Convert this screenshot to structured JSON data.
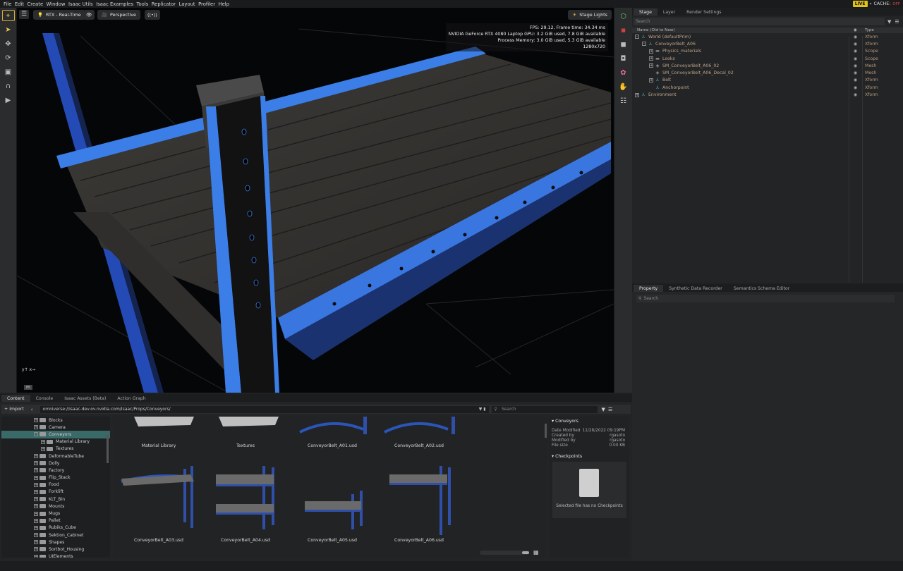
{
  "menu": [
    "File",
    "Edit",
    "Create",
    "Window",
    "Isaac Utils",
    "Isaac Examples",
    "Tools",
    "Replicator",
    "Layout",
    "Profiler",
    "Help"
  ],
  "status_right": {
    "live": "LIVE",
    "cache": "CACHE:",
    "cache_state": "OFF"
  },
  "viewport": {
    "renderer": "RTX - Real-Time",
    "camera": "Perspective",
    "lights": "Stage Lights",
    "stats": [
      "FPS: 29.12, Frame time: 34.34 ms",
      "NVIDIA GeForce RTX 4080 Laptop GPU: 3.2 GiB used, 7.8 GiB available",
      "Process Memory: 3.0 GiB used, 5.3 GiB available",
      "1280x720"
    ],
    "axis_label": "m"
  },
  "stage": {
    "tabs": [
      "Stage",
      "Layer",
      "Render Settings"
    ],
    "search_placeholder": "Search",
    "col_name": "Name (Old to New)",
    "col_type": "Type",
    "rows": [
      {
        "name": "World (defaultPrim)",
        "type": "Xform",
        "indent": 0,
        "toggle": "-",
        "icon": "xform-icon"
      },
      {
        "name": "ConveyorBelt_A06",
        "type": "Xform",
        "indent": 1,
        "toggle": "-",
        "icon": "xform-icon"
      },
      {
        "name": "Physics_materials",
        "type": "Scope",
        "indent": 2,
        "toggle": "+",
        "icon": "folder-icon"
      },
      {
        "name": "Looks",
        "type": "Scope",
        "indent": 2,
        "toggle": "+",
        "icon": "folder-icon"
      },
      {
        "name": "SM_ConveyorBelt_A06_02",
        "type": "Mesh",
        "indent": 2,
        "toggle": "+",
        "icon": "mesh-icon"
      },
      {
        "name": "SM_ConveyorBelt_A06_Decal_02",
        "type": "Mesh",
        "indent": 2,
        "toggle": "",
        "icon": "mesh-icon"
      },
      {
        "name": "Belt",
        "type": "Xform",
        "indent": 2,
        "toggle": "+",
        "icon": "xform-icon"
      },
      {
        "name": "Anchorpoint",
        "type": "Xform",
        "indent": 2,
        "toggle": "",
        "icon": "xform-icon"
      },
      {
        "name": "Environment",
        "type": "Xform",
        "indent": 0,
        "toggle": "+",
        "icon": "xform-icon"
      }
    ]
  },
  "property": {
    "tabs": [
      "Property",
      "Synthetic Data Recorder",
      "Semantics Schema Editor"
    ],
    "search_placeholder": "Search"
  },
  "content": {
    "tabs": [
      "Content",
      "Console",
      "Isaac Assets (Beta)",
      "Action Graph"
    ],
    "import_label": "Import",
    "path": "omniverse://isaac-dev.ov.nvidia.com/Isaac/Props/Conveyors/",
    "search_placeholder": "Search",
    "folders": [
      {
        "name": "Blocks",
        "indent": 0
      },
      {
        "name": "Camera",
        "indent": 0
      },
      {
        "name": "Conveyors",
        "indent": 0,
        "selected": true
      },
      {
        "name": "Material Library",
        "indent": 1
      },
      {
        "name": "Textures",
        "indent": 1
      },
      {
        "name": "DeformableTube",
        "indent": 0
      },
      {
        "name": "Dolly",
        "indent": 0
      },
      {
        "name": "Factory",
        "indent": 0
      },
      {
        "name": "Flip_Stack",
        "indent": 0
      },
      {
        "name": "Food",
        "indent": 0
      },
      {
        "name": "Forklift",
        "indent": 0
      },
      {
        "name": "KLT_Bin",
        "indent": 0
      },
      {
        "name": "Mounts",
        "indent": 0
      },
      {
        "name": "Mugs",
        "indent": 0
      },
      {
        "name": "Pallet",
        "indent": 0
      },
      {
        "name": "Rubiks_Cube",
        "indent": 0
      },
      {
        "name": "Sektion_Cabinet",
        "indent": 0
      },
      {
        "name": "Shapes",
        "indent": 0
      },
      {
        "name": "Sortbot_Housing",
        "indent": 0
      },
      {
        "name": "UIElements",
        "indent": 0
      }
    ],
    "items": [
      "Material Library",
      "Textures",
      "ConveyorBelt_A01.usd",
      "ConveyorBelt_A02.usd",
      "ConveyorBelt_A03.usd",
      "ConveyorBelt_A04.usd",
      "ConveyorBelt_A05.usd",
      "ConveyorBelt_A06.usd"
    ],
    "details": {
      "title": "Conveyors",
      "rows": [
        [
          "Date Modified",
          "11/28/2022 09:19PM"
        ],
        [
          "Created by",
          "rgasoto"
        ],
        [
          "Modified by",
          "rgasoto"
        ],
        [
          "File size",
          "0.00 KB"
        ]
      ],
      "checkpoints_title": "Checkpoints",
      "no_checkpoints": "Selected file has no Checkpoints"
    }
  },
  "colors": {
    "accent": "#3a6fd8",
    "live": "#e2c11b",
    "selection": "#3a6a68"
  }
}
